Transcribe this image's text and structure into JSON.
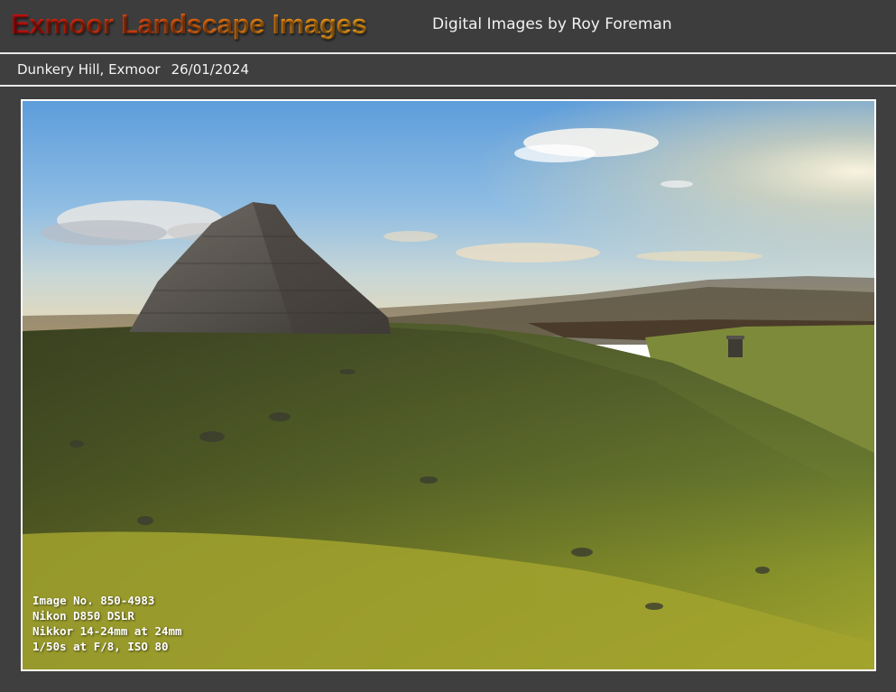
{
  "header": {
    "site_title": "Exmoor Landscape Images",
    "subtitle": "Digital Images by Roy Foreman"
  },
  "caption": {
    "location": "Dunkery Hill, Exmoor",
    "date": "26/01/2024"
  },
  "photo": {
    "subject": "stone-cairn-on-hilltop-at-sunrise",
    "exif": {
      "image_no": "Image No. 850-4983",
      "camera": "Nikon D850 DSLR",
      "lens": "Nikkor 14-24mm at 24mm",
      "settings": "1/50s at F/8,  ISO 80"
    }
  },
  "colors": {
    "background": "#3f3f3f",
    "title_start": "#d20d0d",
    "title_end": "#f5a21a",
    "text": "#f2f2f2"
  }
}
